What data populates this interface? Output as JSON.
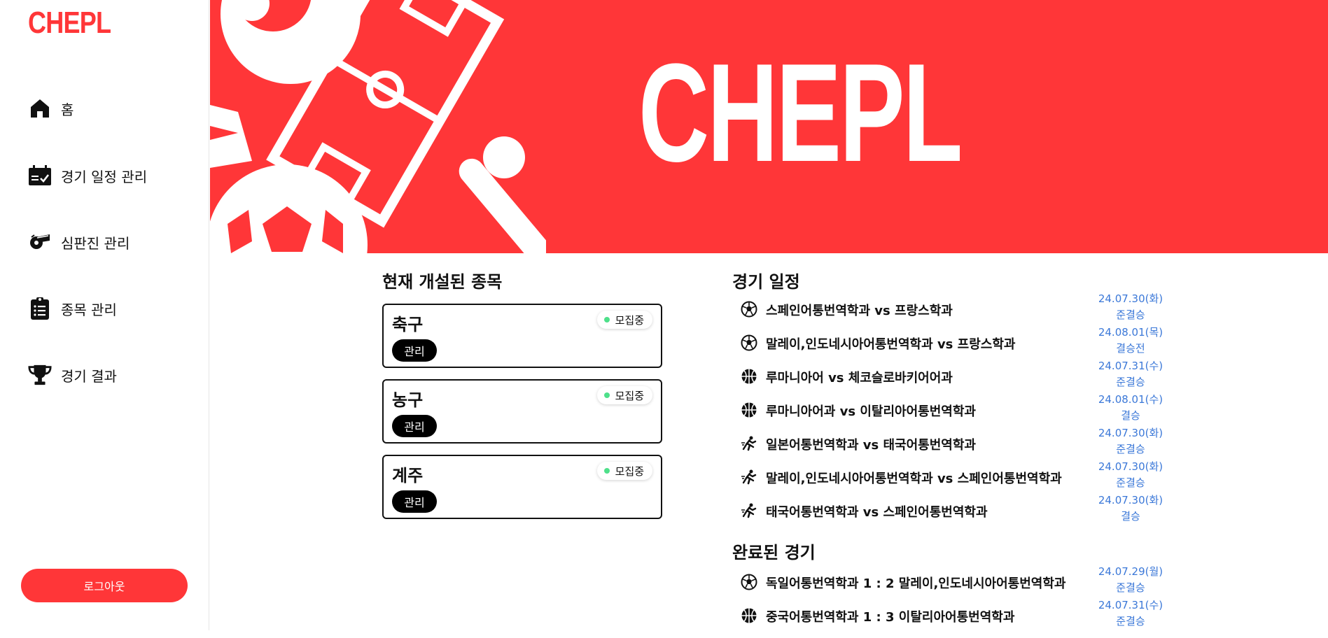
{
  "sidebar": {
    "logo": "CHEPL",
    "items": [
      {
        "label": "홈",
        "icon": "home-icon"
      },
      {
        "label": "경기 일정 관리",
        "icon": "calendar-check-icon"
      },
      {
        "label": "심판진 관리",
        "icon": "whistle-icon"
      },
      {
        "label": "종목 관리",
        "icon": "clipboard-list-icon"
      },
      {
        "label": "경기 결과",
        "icon": "trophy-icon"
      }
    ],
    "logout_label": "로그아웃"
  },
  "banner": {
    "title": "CHEPL",
    "background_color": "#ff3638"
  },
  "sports": {
    "title": "현재 개설된 종목",
    "items": [
      {
        "name": "축구",
        "status": "모집중",
        "button": "관리"
      },
      {
        "name": "농구",
        "status": "모집중",
        "button": "관리"
      },
      {
        "name": "계주",
        "status": "모집중",
        "button": "관리"
      }
    ]
  },
  "schedule": {
    "title": "경기 일정",
    "matches": [
      {
        "sport_icon": "soccer-ball-icon",
        "text": "스페인어통번역학과 vs 프랑스학과",
        "date": "24.07.30(화)",
        "round": "준결승"
      },
      {
        "sport_icon": "soccer-ball-icon",
        "text": "말레이,인도네시아어통번역학과 vs 프랑스학과",
        "date": "24.08.01(목)",
        "round": "결승전"
      },
      {
        "sport_icon": "basketball-icon",
        "text": "루마니아어 vs 체코슬로바키어어과",
        "date": "24.07.31(수)",
        "round": "준결승"
      },
      {
        "sport_icon": "basketball-icon",
        "text": "루마니아어과 vs 이탈리아어통번역학과",
        "date": "24.08.01(수)",
        "round": "결승"
      },
      {
        "sport_icon": "runner-icon",
        "text": "일본어통번역학과 vs 태국어통번역학과",
        "date": "24.07.30(화)",
        "round": "준결승"
      },
      {
        "sport_icon": "runner-icon",
        "text": "말레이,인도네시아어통번역학과 vs 스페인어통번역학과",
        "date": "24.07.30(화)",
        "round": "준결승"
      },
      {
        "sport_icon": "runner-icon",
        "text": "태국어통번역학과 vs 스페인어통번역학과",
        "date": "24.07.30(화)",
        "round": "결승"
      }
    ]
  },
  "completed": {
    "title": "완료된 경기",
    "matches": [
      {
        "sport_icon": "soccer-ball-icon",
        "text": "독일어통번역학과 1 : 2 말레이,인도네시아어통번역학과",
        "date": "24.07.29(월)",
        "round": "준결승"
      },
      {
        "sport_icon": "basketball-icon",
        "text": "중국어통번역학과 1 : 3 이탈리아어통번역학과",
        "date": "24.07.31(수)",
        "round": "준결승"
      }
    ]
  },
  "colors": {
    "accent": "#ff3638",
    "link": "#3b78d8",
    "status_dot": "#4ee08a"
  }
}
